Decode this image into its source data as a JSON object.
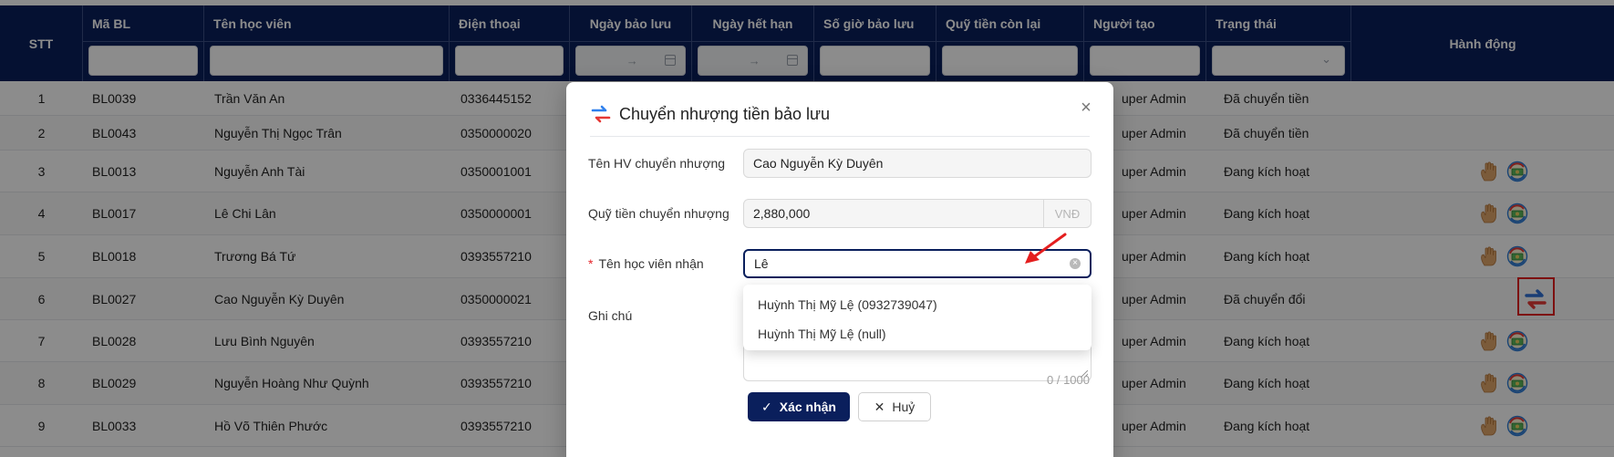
{
  "table": {
    "headers": {
      "stt": "STT",
      "ma_bl": "Mã BL",
      "ten_hoc_vien": "Tên học viên",
      "dien_thoai": "Điện thoại",
      "ngay_bao_luu": "Ngày bảo lưu",
      "ngay_het_han": "Ngày hết hạn",
      "so_gio_bao_luu": "Số giờ bảo lưu",
      "quy_tien_con_lai": "Quỹ tiền còn lại",
      "nguoi_tao": "Người tạo",
      "trang_thai": "Trạng thái",
      "hanh_dong": "Hành động"
    },
    "date_range_separator": "→",
    "rows": [
      {
        "stt": "1",
        "ma": "BL0039",
        "ten": "Trần Văn An",
        "dt": "0336445152",
        "nguoi_tao": "uper Admin",
        "trang_thai": "Đã chuyển tiền",
        "actions": "none"
      },
      {
        "stt": "2",
        "ma": "BL0043",
        "ten": "Nguyễn Thị Ngọc Trân",
        "dt": "0350000020",
        "nguoi_tao": "uper Admin",
        "trang_thai": "Đã chuyển tiền",
        "actions": "none"
      },
      {
        "stt": "3",
        "ma": "BL0013",
        "ten": "Nguyễn Anh Tài",
        "dt": "0350001001",
        "nguoi_tao": "uper Admin",
        "trang_thai": "Đang kích hoạt",
        "actions": "hand-coin"
      },
      {
        "stt": "4",
        "ma": "BL0017",
        "ten": "Lê Chi Lân",
        "dt": "0350000001",
        "nguoi_tao": "uper Admin",
        "trang_thai": "Đang kích hoạt",
        "actions": "hand-coin"
      },
      {
        "stt": "5",
        "ma": "BL0018",
        "ten": "Trương Bá Tứ",
        "dt": "0393557210",
        "nguoi_tao": "uper Admin",
        "trang_thai": "Đang kích hoạt",
        "actions": "hand-coin"
      },
      {
        "stt": "6",
        "ma": "BL0027",
        "ten": "Cao Nguyễn Kỳ Duyên",
        "dt": "0350000021",
        "nguoi_tao": "uper Admin",
        "trang_thai": "Đã chuyển đổi",
        "actions": "transfer"
      },
      {
        "stt": "7",
        "ma": "BL0028",
        "ten": "Lưu Bình Nguyên",
        "dt": "0393557210",
        "nguoi_tao": "uper Admin",
        "trang_thai": "Đang kích hoạt",
        "actions": "hand-coin"
      },
      {
        "stt": "8",
        "ma": "BL0029",
        "ten": "Nguyễn Hoàng Như Quỳnh",
        "dt": "0393557210",
        "nguoi_tao": "uper Admin",
        "trang_thai": "Đang kích hoạt",
        "actions": "hand-coin"
      },
      {
        "stt": "9",
        "ma": "BL0033",
        "ten": "Hồ Võ Thiên Phước",
        "dt": "0393557210",
        "nguoi_tao": "uper Admin",
        "trang_thai": "Đang kích hoạt",
        "actions": "hand-coin"
      }
    ]
  },
  "modal": {
    "title": "Chuyển nhượng tiền bảo lưu",
    "close": "×",
    "fields": {
      "from_label": "Tên HV chuyển nhượng",
      "from_value": "Cao Nguyễn Kỳ Duyên",
      "amount_label": "Quỹ tiền chuyển nhượng",
      "amount_value": "2,880,000",
      "amount_suffix": "VNĐ",
      "required_mark": "*",
      "to_label": "Tên học viên nhận",
      "to_value": "Lê",
      "note_label": "Ghi chú",
      "note_counter": "0 / 1000"
    },
    "dropdown_options": [
      "Huỳnh Thị Mỹ Lệ (0932739047)",
      "Huỳnh Thị Mỹ Lệ (null)"
    ],
    "buttons": {
      "confirm": "Xác nhận",
      "cancel": "Huỷ"
    }
  },
  "colors": {
    "header_bg": "#0a1f5c",
    "primary": "#0a1f5c",
    "highlight": "#e41e1e"
  }
}
